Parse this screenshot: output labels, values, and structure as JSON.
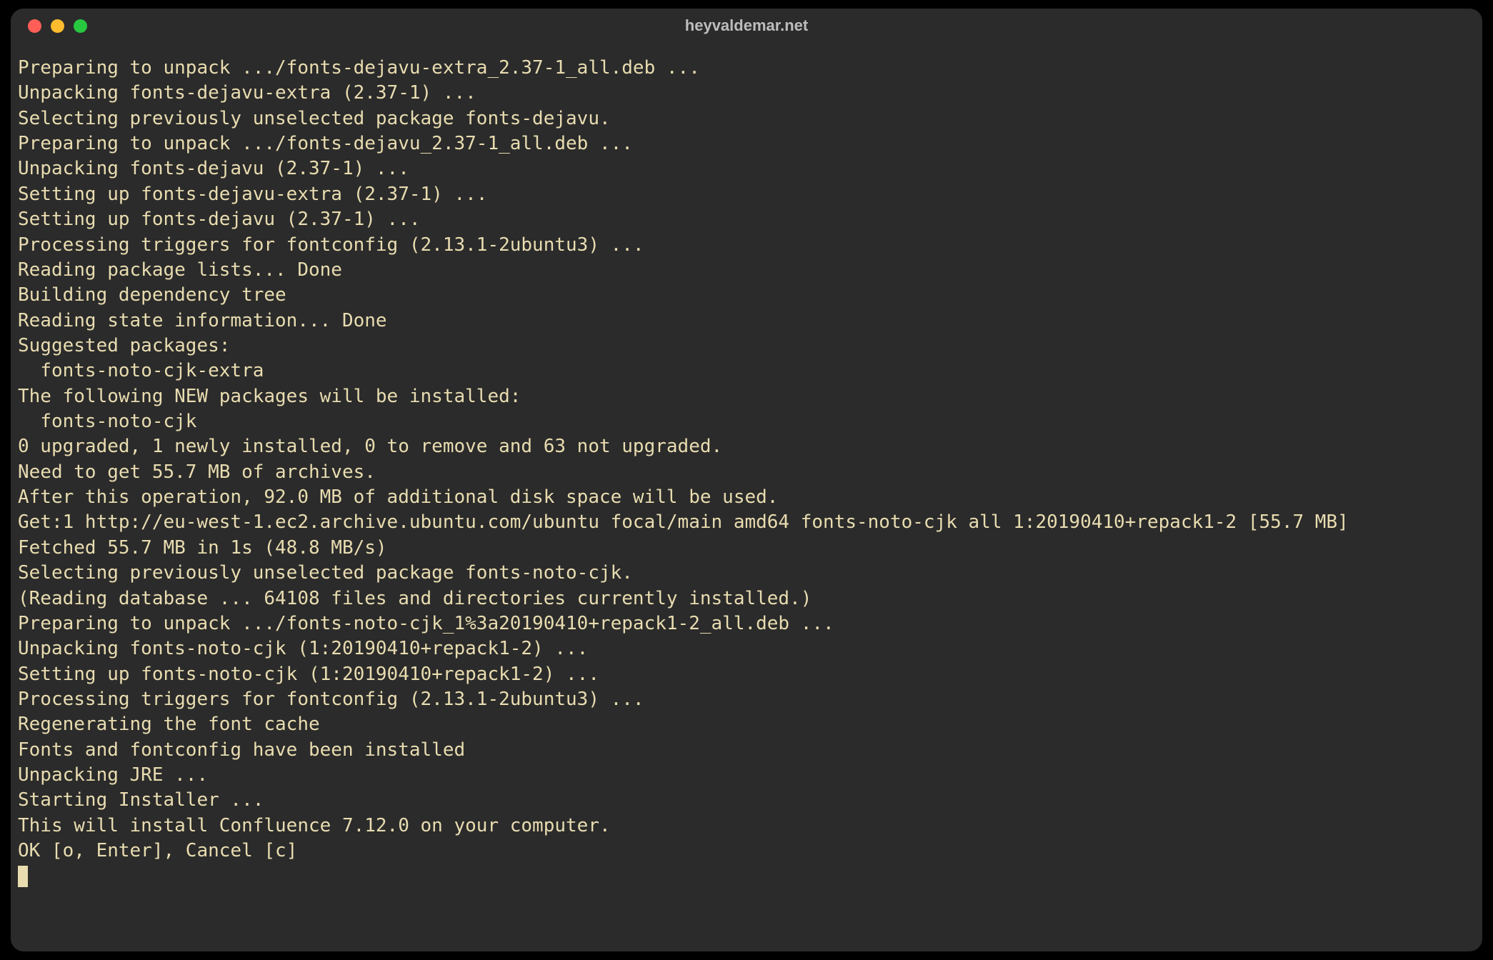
{
  "window": {
    "title": "heyvaldemar.net"
  },
  "terminal": {
    "lines": [
      "Preparing to unpack .../fonts-dejavu-extra_2.37-1_all.deb ...",
      "Unpacking fonts-dejavu-extra (2.37-1) ...",
      "Selecting previously unselected package fonts-dejavu.",
      "Preparing to unpack .../fonts-dejavu_2.37-1_all.deb ...",
      "Unpacking fonts-dejavu (2.37-1) ...",
      "Setting up fonts-dejavu-extra (2.37-1) ...",
      "Setting up fonts-dejavu (2.37-1) ...",
      "Processing triggers for fontconfig (2.13.1-2ubuntu3) ...",
      "Reading package lists... Done",
      "Building dependency tree",
      "Reading state information... Done",
      "Suggested packages:",
      "  fonts-noto-cjk-extra",
      "The following NEW packages will be installed:",
      "  fonts-noto-cjk",
      "0 upgraded, 1 newly installed, 0 to remove and 63 not upgraded.",
      "Need to get 55.7 MB of archives.",
      "After this operation, 92.0 MB of additional disk space will be used.",
      "Get:1 http://eu-west-1.ec2.archive.ubuntu.com/ubuntu focal/main amd64 fonts-noto-cjk all 1:20190410+repack1-2 [55.7 MB]",
      "Fetched 55.7 MB in 1s (48.8 MB/s)",
      "Selecting previously unselected package fonts-noto-cjk.",
      "(Reading database ... 64108 files and directories currently installed.)",
      "Preparing to unpack .../fonts-noto-cjk_1%3a20190410+repack1-2_all.deb ...",
      "Unpacking fonts-noto-cjk (1:20190410+repack1-2) ...",
      "Setting up fonts-noto-cjk (1:20190410+repack1-2) ...",
      "Processing triggers for fontconfig (2.13.1-2ubuntu3) ...",
      "Regenerating the font cache",
      "Fonts and fontconfig have been installed",
      "Unpacking JRE ...",
      "Starting Installer ...",
      "",
      "This will install Confluence 7.12.0 on your computer.",
      "OK [o, Enter], Cancel [c]"
    ]
  }
}
